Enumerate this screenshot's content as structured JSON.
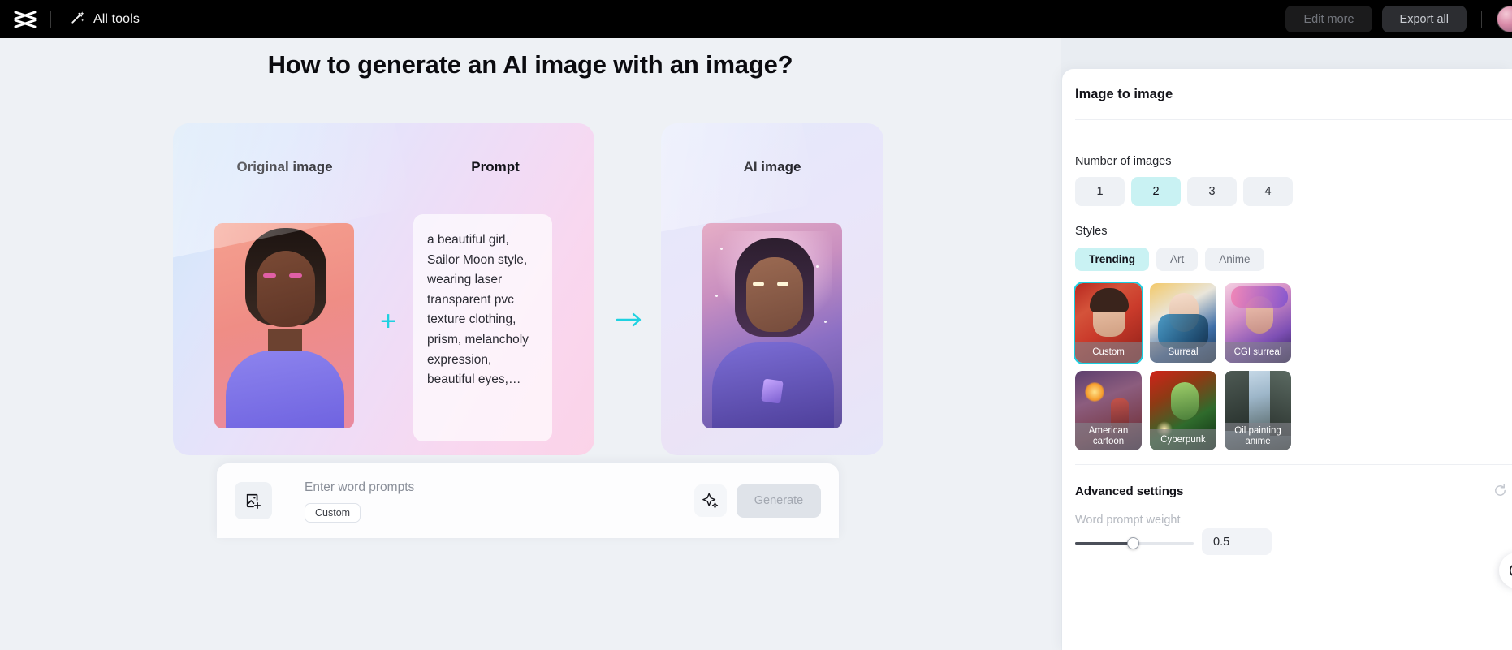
{
  "topbar": {
    "logo_icon": "capcut-logo-icon",
    "all_tools_label": "All tools",
    "all_tools_icon": "magic-wand-icon",
    "edit_more_label": "Edit more",
    "export_all_label": "Export all",
    "avatar_icon": "user-avatar"
  },
  "main": {
    "page_title": "How to generate an AI image with an image?",
    "demo": {
      "original_title": "Original image",
      "prompt_title": "Prompt",
      "plus_icon": "plus-icon",
      "plus_color": "#1ed1e0",
      "arrow_icon": "arrow-right-icon",
      "arrow_color": "#1ed1e0",
      "prompt_text": "a beautiful girl, Sailor Moon style, wearing laser transparent pvc texture clothing, prism, melancholy expression, beautiful eyes,…",
      "result_title": "AI image"
    },
    "input_bar": {
      "upload_icon": "add-image-icon",
      "placeholder": "Enter word prompts",
      "chip_label": "Custom",
      "sparkle_icon": "sparkle-icon",
      "generate_label": "Generate"
    }
  },
  "panel": {
    "title": "Image to image",
    "number_of_images": {
      "label": "Number of images",
      "options": [
        "1",
        "2",
        "3",
        "4"
      ],
      "selected": "2"
    },
    "styles": {
      "label": "Styles",
      "tabs": [
        {
          "label": "Trending",
          "selected": true
        },
        {
          "label": "Art",
          "selected": false
        },
        {
          "label": "Anime",
          "selected": false
        }
      ],
      "items": [
        {
          "label": "Custom",
          "selected": true
        },
        {
          "label": "Surreal",
          "selected": false
        },
        {
          "label": "CGI surreal",
          "selected": false
        },
        {
          "label": "American cartoon",
          "selected": false
        },
        {
          "label": "Cyberpunk",
          "selected": false
        },
        {
          "label": "Oil painting anime",
          "selected": false
        }
      ]
    },
    "advanced": {
      "label": "Advanced settings",
      "reset_icon": "reset-icon",
      "weight_label": "Word prompt weight",
      "weight_value": "0.5",
      "fab_icon": "help-icon"
    },
    "accent_selected": "#c9f2f3",
    "accent_border": "#18d0e2"
  }
}
